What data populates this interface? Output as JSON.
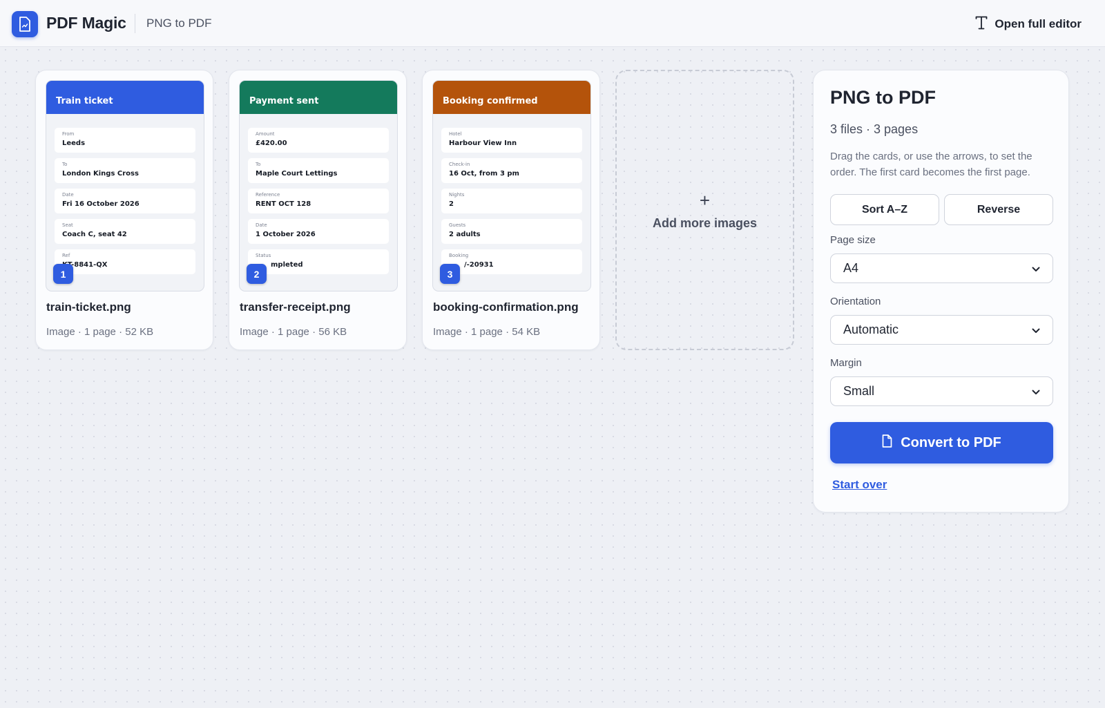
{
  "header": {
    "brand": "PDF Magic",
    "subtitle": "PNG to PDF",
    "open_editor_label": "Open full editor"
  },
  "colors": {
    "accent": "#2f5ce0",
    "train_ticket_header": "#2f5ce0",
    "payment_header": "#147a5c",
    "booking_header": "#b4530b"
  },
  "files": [
    {
      "order": "1",
      "name": "train-ticket.png",
      "meta": "Image · 1 page · 52 KB",
      "preview": {
        "title": "Train ticket",
        "fields": [
          {
            "label": "From",
            "value": "Leeds"
          },
          {
            "label": "To",
            "value": "London Kings Cross"
          },
          {
            "label": "Date",
            "value": "Fri 16 October 2026"
          },
          {
            "label": "Seat",
            "value": "Coach C, seat 42"
          },
          {
            "label": "Ref",
            "value": "KT-8841-QX"
          }
        ]
      }
    },
    {
      "order": "2",
      "name": "transfer-receipt.png",
      "meta": "Image · 1 page · 56 KB",
      "preview": {
        "title": "Payment sent",
        "fields": [
          {
            "label": "Amount",
            "value": "£420.00"
          },
          {
            "label": "To",
            "value": "Maple Court Lettings"
          },
          {
            "label": "Reference",
            "value": "RENT OCT 128"
          },
          {
            "label": "Date",
            "value": "1 October 2026"
          },
          {
            "label": "Status",
            "value": "mpleted"
          }
        ]
      }
    },
    {
      "order": "3",
      "name": "booking-confirmation.png",
      "meta": "Image · 1 page · 54 KB",
      "preview": {
        "title": "Booking confirmed",
        "fields": [
          {
            "label": "Hotel",
            "value": "Harbour View Inn"
          },
          {
            "label": "Check-in",
            "value": "16 Oct, from 3 pm"
          },
          {
            "label": "Nights",
            "value": "2"
          },
          {
            "label": "Guests",
            "value": "2 adults"
          },
          {
            "label": "Booking",
            "value": "/-20931"
          }
        ]
      }
    }
  ],
  "add_more": {
    "plus": "+",
    "label": "Add more images"
  },
  "panel": {
    "title": "PNG to PDF",
    "count": "3 files · 3 pages",
    "help": "Drag the cards, or use the arrows, to set the order. The first card becomes the first page.",
    "sort_label": "Sort A–Z",
    "reverse_label": "Reverse",
    "page_size_label": "Page size",
    "page_size_value": "A4",
    "orientation_label": "Orientation",
    "orientation_value": "Automatic",
    "margin_label": "Margin",
    "margin_value": "Small",
    "convert_label": "Convert to PDF",
    "start_over_label": "Start over"
  }
}
